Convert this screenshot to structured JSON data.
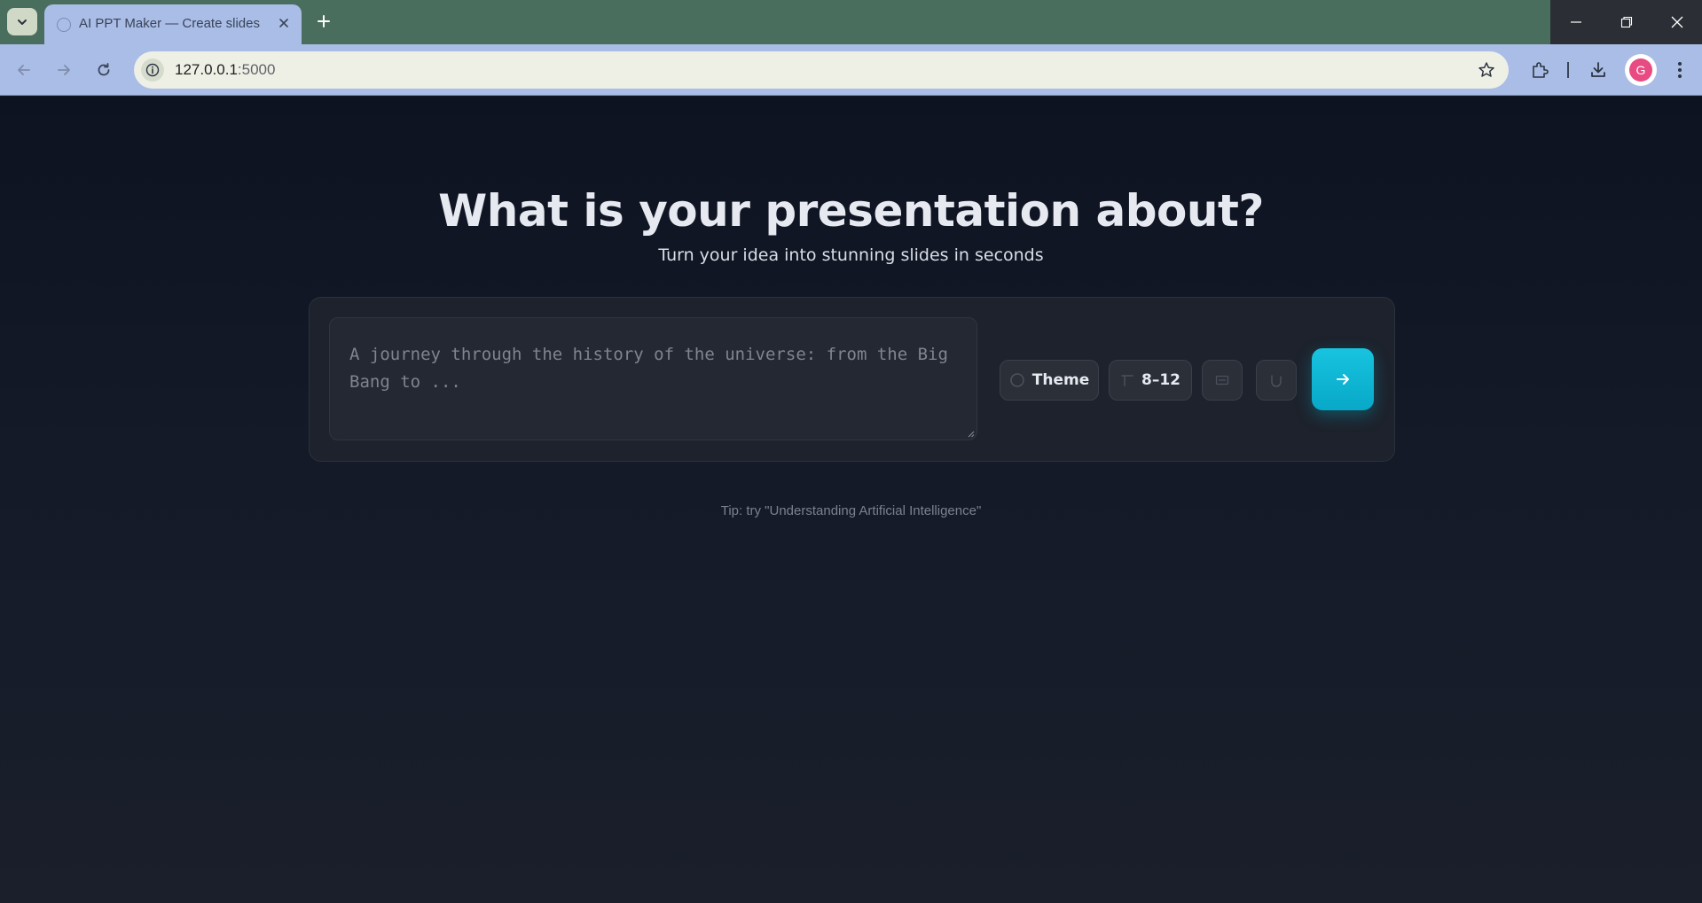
{
  "browser": {
    "tab": {
      "title": "AI PPT Maker — Create slides"
    },
    "url": {
      "host": "127.0.0.1",
      "port": ":5000"
    },
    "profile_initial": "G"
  },
  "icons": {
    "tab_list": "chevron-down-icon",
    "tab_favicon": "globe-icon",
    "tab_close": "close-icon",
    "new_tab": "plus-icon",
    "back": "arrow-left-icon",
    "forward": "arrow-right-icon",
    "reload": "reload-icon",
    "site_info": "info-icon",
    "bookmark": "star-icon",
    "extensions": "puzzle-icon",
    "downloads": "download-icon",
    "menu": "kebab-icon",
    "theme": "palette-icon",
    "slide_count": "slides-icon",
    "layout": "layout-icon",
    "image": "image-icon",
    "submit": "arrow-right-icon"
  },
  "main": {
    "heading": "What is your presentation about?",
    "subheading": "Turn your idea into stunning slides in seconds",
    "prompt": {
      "value": "",
      "placeholder": "A journey through the history of the universe: from the Big Bang to ..."
    },
    "options": {
      "theme_label": "Theme",
      "slide_count_label": "8–12"
    },
    "tip": "Tip: try \"Understanding Artificial Intelligence\""
  },
  "colors": {
    "accent": "#0fb8d6",
    "background": "#111827",
    "panel": "#1d222c",
    "tab_strip": "#4a6e5e",
    "toolbar": "#a9bde6"
  }
}
